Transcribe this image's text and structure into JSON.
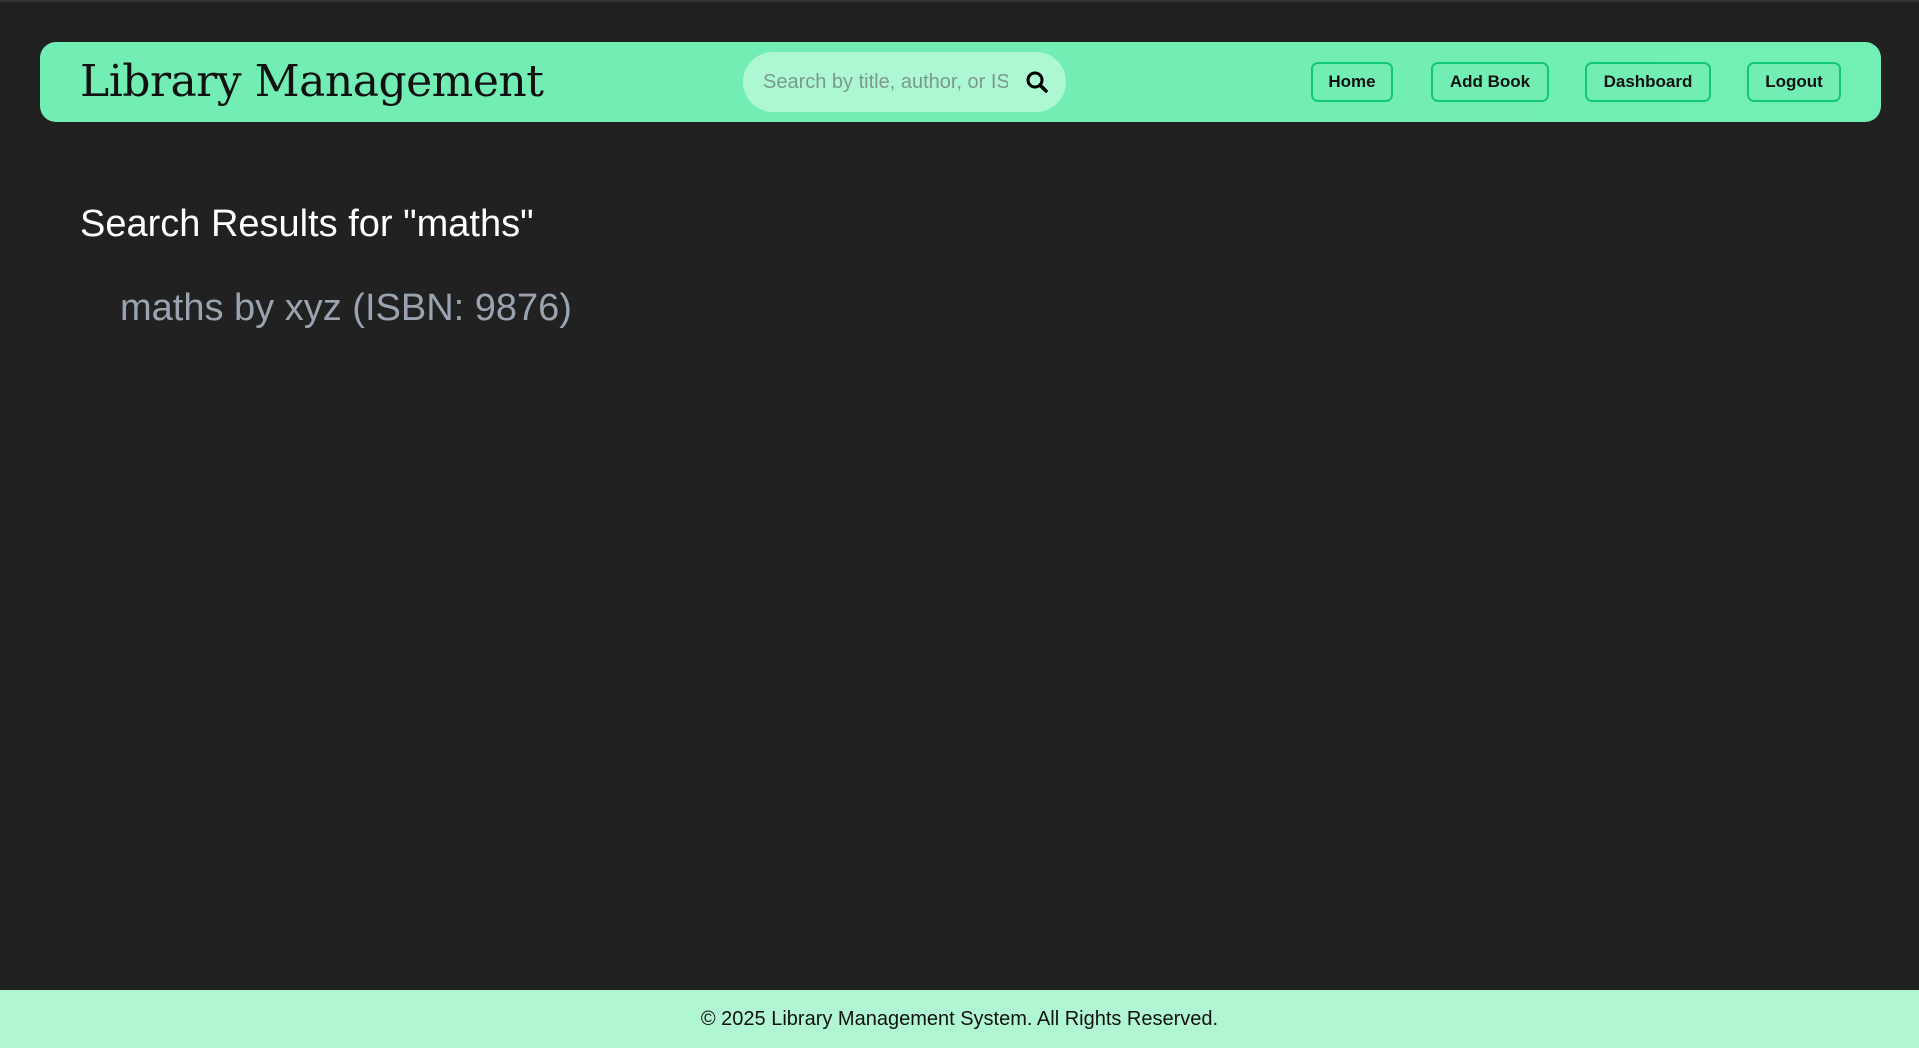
{
  "header": {
    "brand": "Library Management",
    "search": {
      "placeholder": "Search by title, author, or ISBN",
      "value": "",
      "icon": "search-icon"
    },
    "nav": [
      {
        "label": "Home"
      },
      {
        "label": "Add Book"
      },
      {
        "label": "Dashboard"
      },
      {
        "label": "Logout"
      }
    ]
  },
  "main": {
    "title": "Search Results for \"maths\"",
    "results": [
      {
        "text": "maths by xyz (ISBN: 9876)"
      }
    ]
  },
  "footer": {
    "text": "© 2025 Library Management System. All Rights Reserved."
  },
  "colors": {
    "background": "#212121",
    "navbar": "#72eeb4",
    "footer": "#b1f6d3",
    "button_border": "#10c878",
    "result_text": "#9aa3b0"
  }
}
